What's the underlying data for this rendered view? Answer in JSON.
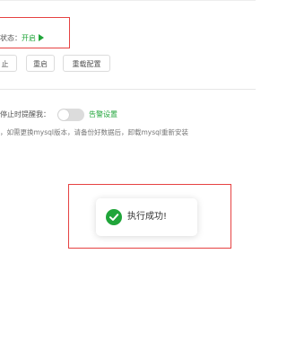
{
  "status": {
    "label": "状态：",
    "value": "开启",
    "color": "#20a53a"
  },
  "buttons": {
    "stop": "止",
    "restart": "重启",
    "reload": "重载配置"
  },
  "alert": {
    "label": "停止时提醒我：",
    "toggle_on": false,
    "settings_link": "告警设置"
  },
  "note": "，如需更换mysql版本，请备份好数据后，卸载mysql重新安装",
  "toast": {
    "message": "执行成功!",
    "icon": "check-circle-icon",
    "accent": "#20a53a"
  },
  "highlight_color": "#e64242"
}
